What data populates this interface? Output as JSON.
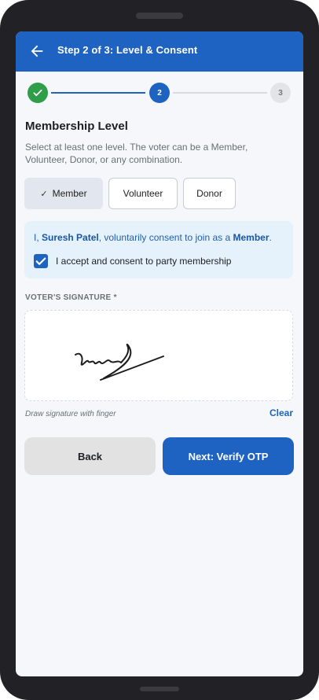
{
  "header": {
    "title": "Step 2 of 3: Level & Consent"
  },
  "stepper": {
    "step2": "2",
    "step3": "3"
  },
  "membership": {
    "title": "Membership Level",
    "description": "Select at least one level. The voter can be a Member, Volunteer, Donor, or any combination.",
    "options": [
      {
        "label": "Member",
        "selected": true
      },
      {
        "label": "Volunteer",
        "selected": false
      },
      {
        "label": "Donor",
        "selected": false
      }
    ]
  },
  "consent": {
    "prefix": "I, ",
    "name": "Suresh Patel",
    "middle": ", voluntarily consent to join as a ",
    "level": "Member",
    "suffix": ".",
    "checkbox_label": "I accept and consent to party membership",
    "checked": true
  },
  "signature": {
    "label": "VOTER'S SIGNATURE *",
    "hint": "Draw signature with finger",
    "clear_label": "Clear"
  },
  "actions": {
    "back_label": "Back",
    "next_label": "Next: Verify OTP"
  },
  "colors": {
    "primary": "#1f63c2",
    "success": "#2e9e49",
    "consent_bg": "#e5f1fb"
  }
}
